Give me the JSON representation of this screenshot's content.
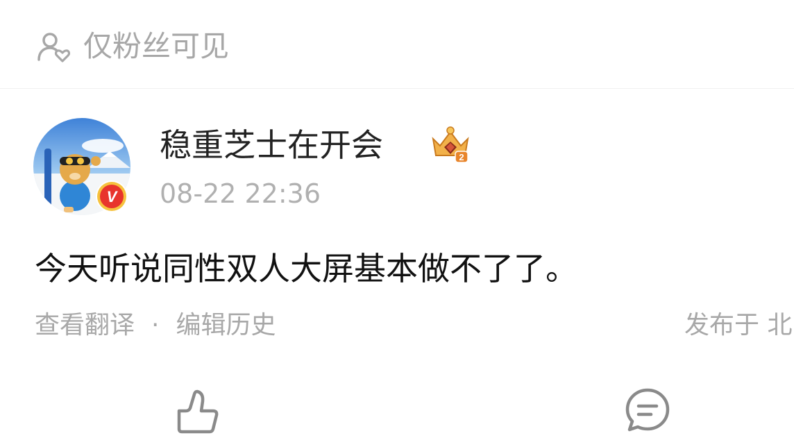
{
  "visibility": {
    "label": "仅粉丝可见",
    "icon": "fans-only-icon"
  },
  "post": {
    "author": {
      "name": "稳重芝士在开会",
      "verified_badge": "V",
      "badge_icon": "crown-level-badge-icon"
    },
    "timestamp": "08-22 22:36",
    "content": "今天听说同性双人大屏基本做不了了。",
    "actions": {
      "translate": "查看翻译",
      "separator": "·",
      "edit_history": "编辑历史",
      "published_at": "发布于 北"
    }
  },
  "bottom_actions": {
    "like_icon": "thumbs-up-icon",
    "comment_icon": "comment-icon"
  },
  "colors": {
    "muted": "#a8a8a8",
    "verified_red": "#e8342c",
    "crown_gold": "#e8a23a"
  }
}
